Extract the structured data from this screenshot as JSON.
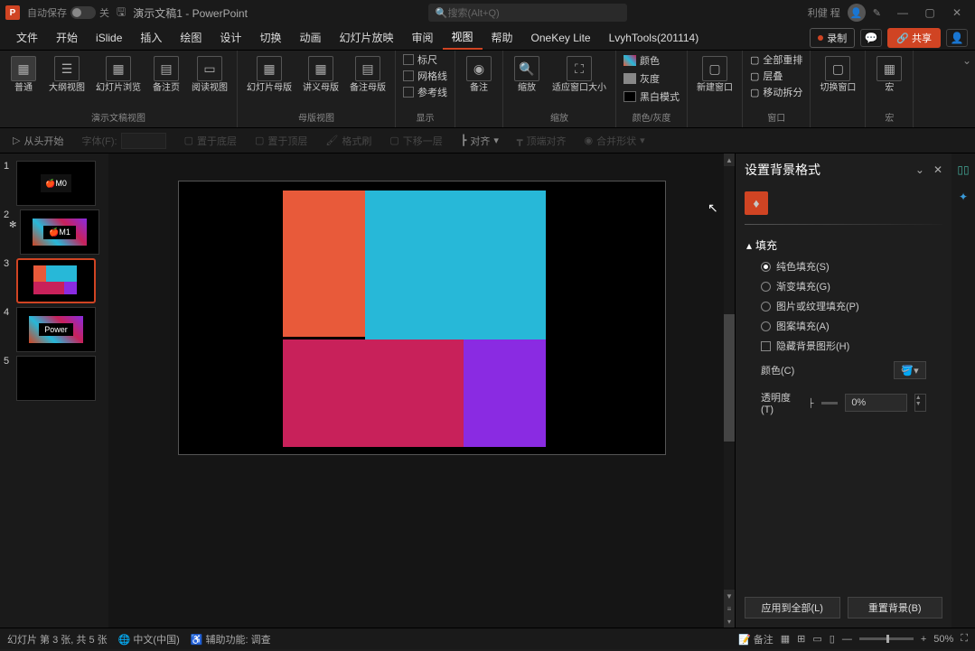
{
  "title": {
    "autosave": "自动保存",
    "switch": "关",
    "doc": "演示文稿1  -  PowerPoint",
    "search": "搜索(Alt+Q)",
    "user": "利健 程"
  },
  "menu": {
    "file": "文件",
    "home": "开始",
    "islide": "iSlide",
    "insert": "插入",
    "draw": "绘图",
    "design": "设计",
    "trans": "切换",
    "anim": "动画",
    "show": "幻灯片放映",
    "review": "审阅",
    "view": "视图",
    "help": "帮助",
    "onekey": "OneKey Lite",
    "lvyh": "LvyhTools(201114)",
    "rec": "录制",
    "share": "共享"
  },
  "ribbon": {
    "g1": {
      "normal": "普通",
      "outline": "大纲视图",
      "browse": "幻灯片浏览",
      "notes": "备注页",
      "read": "阅读视图",
      "lbl": "演示文稿视图"
    },
    "g2": {
      "master": "幻灯片母版",
      "hmaster": "讲义母版",
      "nmaster": "备注母版",
      "lbl": "母版视图"
    },
    "g3": {
      "ruler": "标尺",
      "grid": "网格线",
      "guide": "参考线",
      "notes": "备注",
      "lbl": "显示"
    },
    "g4": {
      "zoom": "缩放",
      "fit": "适应窗口大小",
      "lbl": "缩放"
    },
    "g5": {
      "color": "颜色",
      "gray": "灰度",
      "bw": "黑白模式",
      "lbl": "颜色/灰度"
    },
    "g6": {
      "new": "新建窗口",
      "all": "全部重排",
      "cascade": "层叠",
      "move": "移动拆分",
      "switch": "切换窗口",
      "lbl": "窗口"
    },
    "g7": {
      "macro": "宏",
      "lbl": "宏"
    }
  },
  "aux": {
    "start": "从头开始",
    "font": "字体(F):",
    "sel_layer": "置于底层",
    "top_layer": "置于顶层",
    "fmt": "格式刷",
    "down": "下移一层",
    "align": "对齐",
    "topalign": "顶端对齐",
    "merge": "合并形状"
  },
  "thumbs": [
    {
      "n": "1"
    },
    {
      "n": "2"
    },
    {
      "n": "3"
    },
    {
      "n": "4"
    },
    {
      "n": "5"
    }
  ],
  "tpower": "Power",
  "fmt": {
    "title": "设置背景格式",
    "fill": "填充",
    "solid": "纯色填充(S)",
    "grad": "渐变填充(G)",
    "pic": "图片或纹理填充(P)",
    "pattern": "图案填充(A)",
    "hide": "隐藏背景图形(H)",
    "color": "颜色(C)",
    "opacity": "透明度(T)",
    "opval": "0%",
    "apply": "应用到全部(L)",
    "reset": "重置背景(B)"
  },
  "status": {
    "slide": "幻灯片 第 3 张, 共 5 张",
    "lang": "中文(中国)",
    "acc": "辅助功能: 调查",
    "notes": "备注",
    "zoom": "50%"
  }
}
